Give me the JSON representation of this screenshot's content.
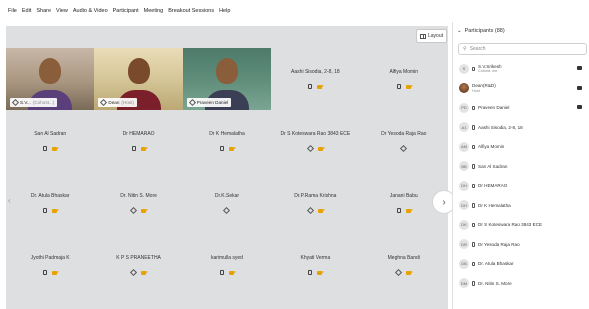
{
  "menu": [
    "File",
    "Edit",
    "Share",
    "View",
    "Audio & Video",
    "Participant",
    "Meeting",
    "Breakout Sessions",
    "Help"
  ],
  "layout_label": "Layout",
  "video_tiles": [
    {
      "name": "S.V...",
      "role": "(Cohost...)"
    },
    {
      "name": "Dean",
      "role": "(Host)"
    },
    {
      "name": "Praveen Daniel",
      "role": ""
    }
  ],
  "grid_rows": [
    [
      {
        "name": "Aashi Sisodia, 2-8, 18"
      },
      {
        "name": "Alfiya Momin"
      }
    ],
    [
      {
        "name": "San Al Sadran"
      },
      {
        "name": "Dr HEMARAO"
      },
      {
        "name": "Dr K Hemalatha"
      },
      {
        "name": "Dr S Koteswara Rao 3843 ECE"
      },
      {
        "name": "Dr Yesoda Raja Rao"
      }
    ],
    [
      {
        "name": "Dr. Atula Bhaskar"
      },
      {
        "name": "Dr. Nitin S. More"
      },
      {
        "name": "Dr.K.Sekar"
      },
      {
        "name": "Dr.P.Rama Krishna"
      },
      {
        "name": "Janani Babu"
      }
    ],
    [
      {
        "name": "Jyothi Padmaja K"
      },
      {
        "name": "K P S PRANEETHA"
      },
      {
        "name": "karimulla syed"
      },
      {
        "name": "Khyati Verma"
      },
      {
        "name": "Meghna Bandi"
      }
    ]
  ],
  "panel": {
    "title": "Participants (88)",
    "search_placeholder": "Search",
    "participants": [
      {
        "initials": "S",
        "name": "S.V.Srikesh",
        "sub": "Cohost, me"
      },
      {
        "initials": "",
        "name": "Dean(R&D)",
        "sub": "Host"
      },
      {
        "initials": "PD",
        "name": "Praveen Daniel",
        "sub": ""
      },
      {
        "initials": "A1",
        "name": "Aashi Sisodia, 2-8, 18",
        "sub": ""
      },
      {
        "initials": "AM",
        "name": "Alfiya Momin",
        "sub": ""
      },
      {
        "initials": "BB",
        "name": "San Al Sadran",
        "sub": ""
      },
      {
        "initials": "DH",
        "name": "Dr HEMARAO",
        "sub": ""
      },
      {
        "initials": "DH",
        "name": "Dr K Hemalatha",
        "sub": ""
      },
      {
        "initials": "DK",
        "name": "Dr S Koteswara Rao 3843 ECE",
        "sub": ""
      },
      {
        "initials": "DR",
        "name": "Dr Yesoda Raja Rao",
        "sub": ""
      },
      {
        "initials": "DB",
        "name": "Dr. Atula Bhaskar",
        "sub": ""
      },
      {
        "initials": "DM",
        "name": "Dr. Nitin S. More",
        "sub": ""
      }
    ]
  }
}
